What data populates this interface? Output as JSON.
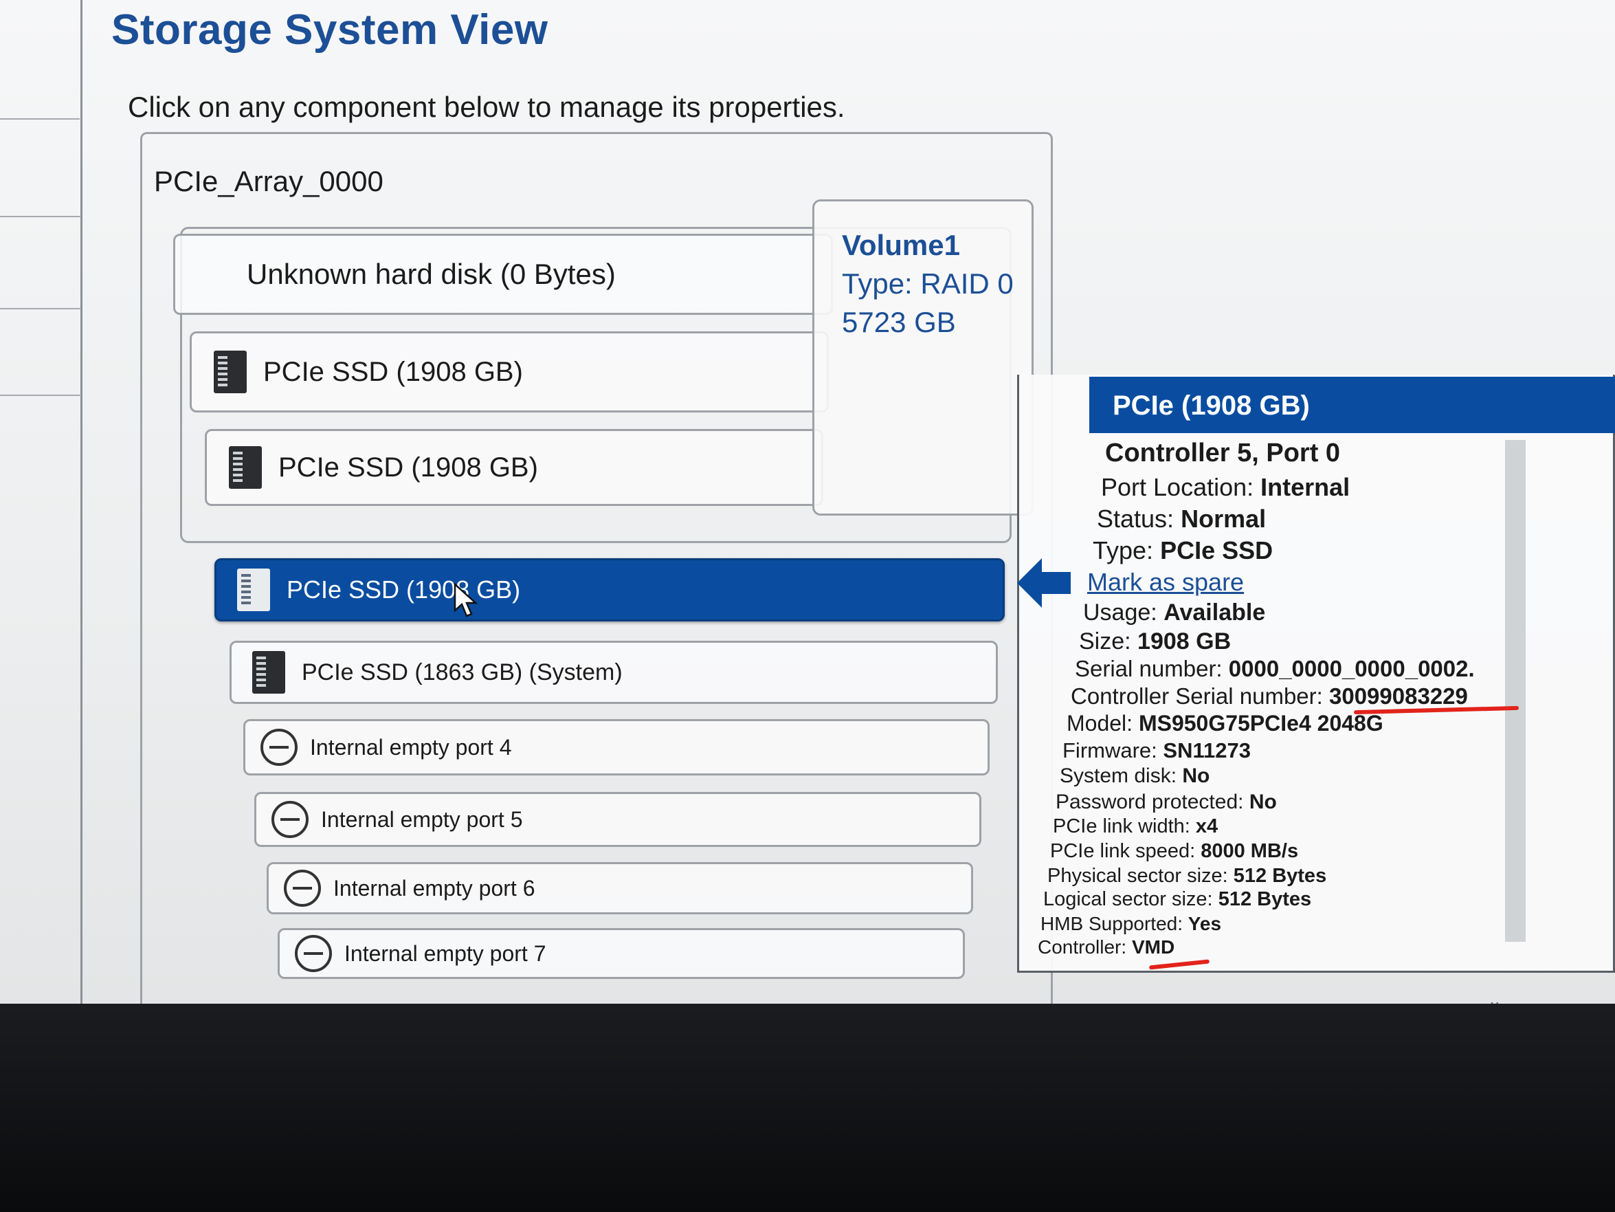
{
  "page": {
    "title": "Storage System View",
    "subtitle": "Click on any component below to manage its properties."
  },
  "array": {
    "name": "PCIe_Array_0000",
    "disks": [
      {
        "label": "Unknown hard disk (0 Bytes)",
        "icon": "none"
      },
      {
        "label": "PCIe SSD (1908 GB)",
        "icon": "ssd-icon"
      },
      {
        "label": "PCIe SSD (1908 GB)",
        "icon": "ssd-icon"
      }
    ]
  },
  "volume": {
    "name": "Volume1",
    "type": "Type: RAID 0",
    "size": "5723 GB"
  },
  "devices": [
    {
      "label": "PCIe SSD (1908 GB)",
      "icon": "ssd-icon",
      "selected": true
    },
    {
      "label": "PCIe SSD (1863 GB) (System)",
      "icon": "ssd-icon",
      "selected": false
    },
    {
      "label": "Internal empty port 4",
      "icon": "empty-port-icon",
      "selected": false
    },
    {
      "label": "Internal empty port 5",
      "icon": "empty-port-icon",
      "selected": false
    },
    {
      "label": "Internal empty port 6",
      "icon": "empty-port-icon",
      "selected": false
    },
    {
      "label": "Internal empty port 7",
      "icon": "empty-port-icon",
      "selected": false
    }
  ],
  "details": {
    "header": "PCIe (1908 GB)",
    "controller_port": "Controller 5, Port 0",
    "mark_as_spare": "Mark as spare",
    "properties": [
      {
        "key": "Port Location:",
        "value": "Internal"
      },
      {
        "key": "Status:",
        "value": "Normal"
      },
      {
        "key": "Type:",
        "value": "PCIe SSD"
      },
      {
        "key": "Usage:",
        "value": "Available"
      },
      {
        "key": "Size:",
        "value": "1908 GB"
      },
      {
        "key": "Serial number:",
        "value": "0000_0000_0000_0002."
      },
      {
        "key": "Controller Serial number:",
        "value": "30099083229"
      },
      {
        "key": "Model:",
        "value": "MS950G75PCIe4 2048G"
      },
      {
        "key": "Firmware:",
        "value": "SN11273"
      },
      {
        "key": "System disk:",
        "value": "No"
      },
      {
        "key": "Password protected:",
        "value": "No"
      },
      {
        "key": "PCIe link width:",
        "value": "x4"
      },
      {
        "key": "PCIe link speed:",
        "value": "8000 MB/s"
      },
      {
        "key": "Physical sector size:",
        "value": "512 Bytes"
      },
      {
        "key": "Logical sector size:",
        "value": "512 Bytes"
      },
      {
        "key": "HMB Supported:",
        "value": "Yes"
      },
      {
        "key": "Controller:",
        "value": "VMD"
      }
    ]
  },
  "colors": {
    "accent": "#0a4da0",
    "title": "#1c4f96",
    "annotation": "#e2241b"
  }
}
